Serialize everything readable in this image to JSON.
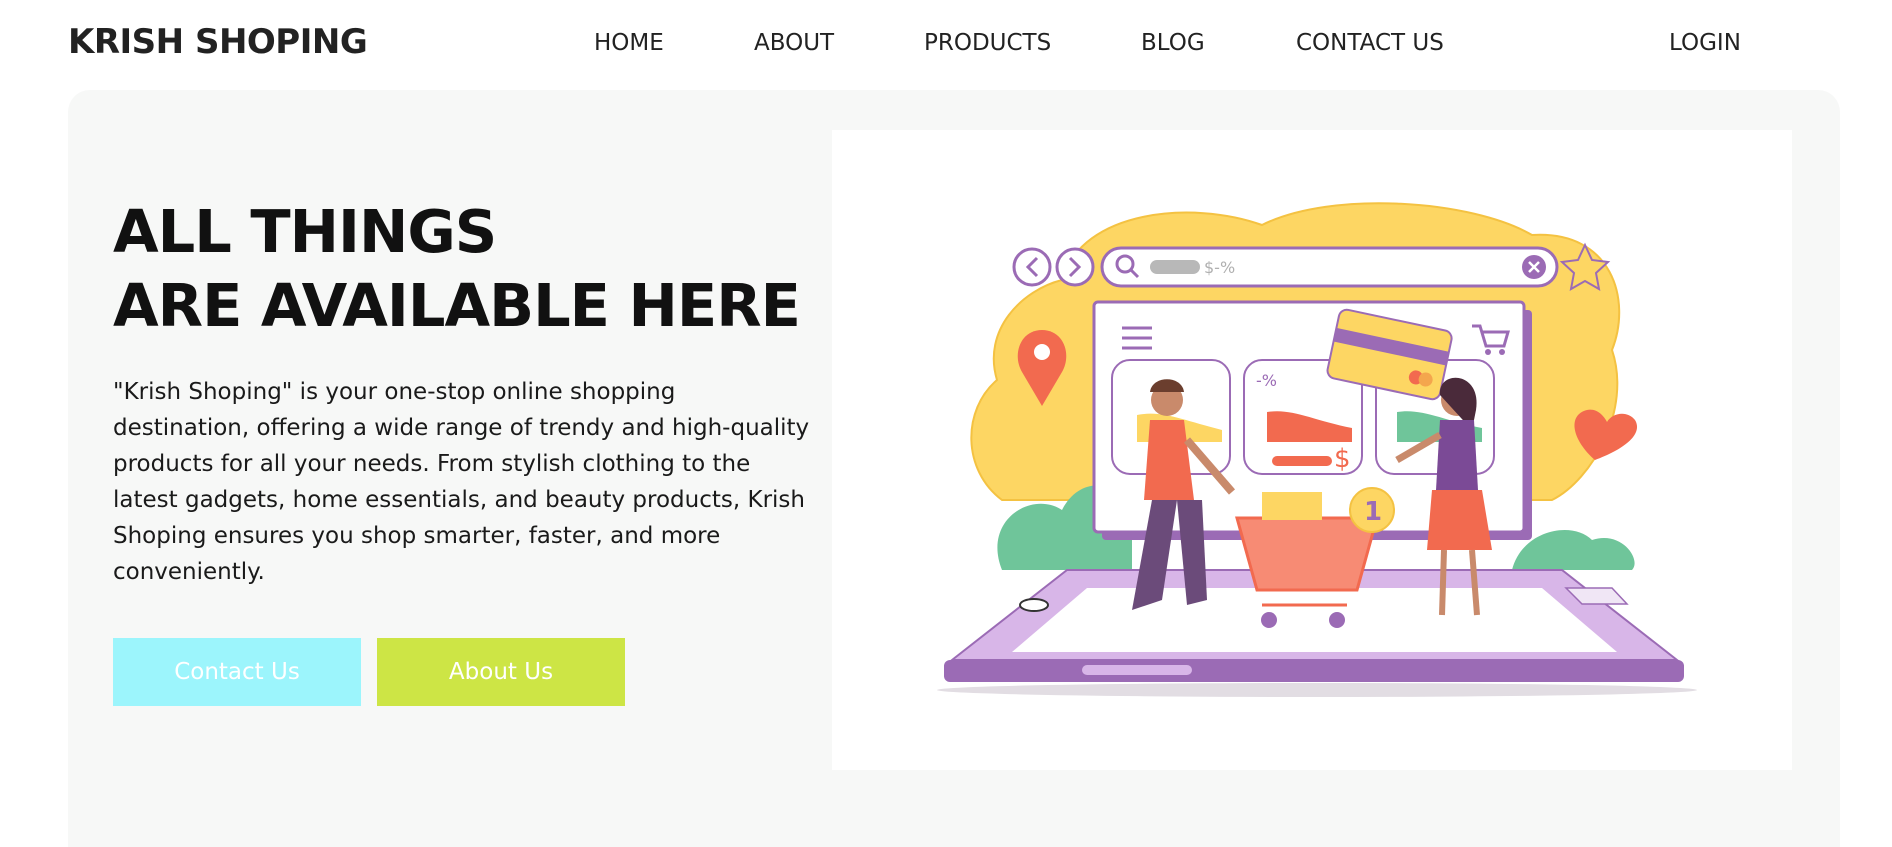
{
  "nav": {
    "brand": "KRISH SHOPING",
    "links": [
      {
        "label": "HOME"
      },
      {
        "label": "ABOUT"
      },
      {
        "label": "PRODUCTS"
      },
      {
        "label": "BLOG"
      },
      {
        "label": "CONTACT US"
      }
    ],
    "login": "LOGIN"
  },
  "hero": {
    "title_line1": "ALL THINGS",
    "title_line2": "ARE AVAILABLE HERE",
    "description": "\"Krish Shoping\" is your one-stop online shopping destination, offering a wide range of trendy and high-quality products for all your needs. From stylish clothing to the latest gadgets, home essentials, and beauty products, Krish Shoping ensures you shop smarter, faster, and more conveniently.",
    "contact_button": "Contact Us",
    "about_button": "About Us"
  },
  "illustration": {
    "search_text": "$-%",
    "discount_label": "-%",
    "price_symbol": "$",
    "cart_count": "1",
    "icons": [
      "back-arrow-icon",
      "forward-arrow-icon",
      "search-icon",
      "close-icon",
      "star-icon",
      "location-pin-icon",
      "heart-icon",
      "menu-icon",
      "cart-icon",
      "credit-card-icon"
    ]
  },
  "colors": {
    "contact_button": "#9cf5fc",
    "about_button": "#cde545",
    "hero_background": "#f7f8f7",
    "accent_purple": "#9b6bb5",
    "accent_yellow": "#fdd663",
    "accent_red": "#f26a4f"
  }
}
